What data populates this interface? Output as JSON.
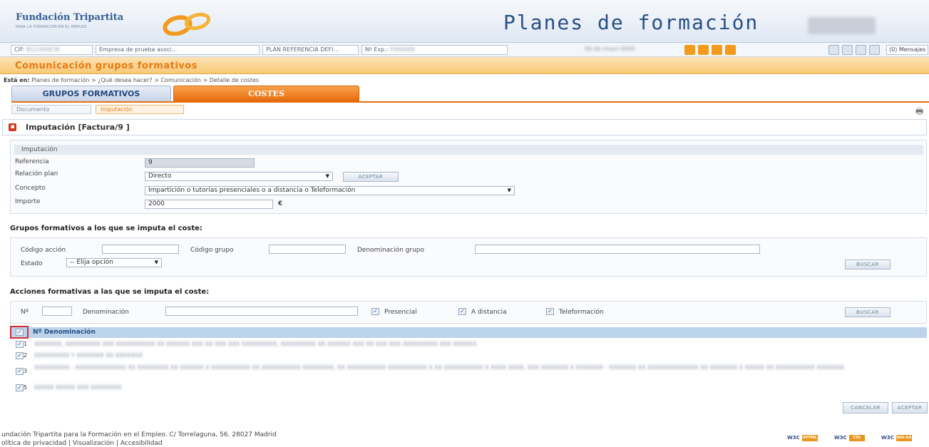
{
  "header": {
    "logo_name": "Fundación Tripartita",
    "logo_subtitle": "PARA LA FORMACIÓN EN EL EMPLEO",
    "app_title": "Planes de formación"
  },
  "infobar": {
    "cif_label": "CIF:",
    "cif_value": "B12345678",
    "empresa": "Empresa de prueba asoci...",
    "plan": "PLAN REFERENCIA DEFI...",
    "exp_label": "Nº Exp.:",
    "exp_value": "F000000",
    "date": "00 de mayo 0000",
    "messages": "(0) Mensajes"
  },
  "section": {
    "title": "Comunicación grupos formativos"
  },
  "breadcrumb": {
    "prefix": "Está en:",
    "path": "Planes de formación > ¿Qué desea hacer? > Comunicación > Detalle de costes"
  },
  "tabs": {
    "grupos": "GRUPOS FORMATIVOS",
    "costes": "COSTES"
  },
  "subtabs": {
    "documento": "Documento",
    "imputacion": "Imputación"
  },
  "panel": {
    "title": "Imputación [Factura/9 ]"
  },
  "imputacion": {
    "header": "Imputación",
    "referencia_label": "Referencia",
    "referencia_value": "9",
    "relacion_label": "Relación plan",
    "relacion_value": "Directo",
    "aceptar_small": "ACEPTAR",
    "concepto_label": "Concepto",
    "concepto_value": "Impartición o tutorías presenciales o a distancia o Teleformación",
    "importe_label": "Importe",
    "importe_value": "2000",
    "currency": "€"
  },
  "grupos_search": {
    "title": "Grupos formativos a los que se imputa el coste:",
    "codigo_accion": "Código acción",
    "codigo_grupo": "Código grupo",
    "denominacion_grupo": "Denominación grupo",
    "estado": "Estado",
    "estado_value": "-- Elija opción",
    "buscar": "BUSCAR"
  },
  "acciones_search": {
    "title": "Acciones formativas a las que se imputa el coste:",
    "num_label": "Nº",
    "denominacion_label": "Denominación",
    "presencial": "Presencial",
    "a_distancia": "A distancia",
    "teleformacion": "Teleformación",
    "buscar": "BUSCAR"
  },
  "table": {
    "header": "Nº Denominación",
    "check_mark": "✓",
    "rows": [
      {
        "num": "1",
        "den": "XXXXXXX, XXXXXXXXX XXX XXXXXXXXXX XX XXXXXX XXX XX XXX XXX XXXXXXXXX, XXXXXXXXX XX XXXXXX XXX XX XXX XXX XXXXXXXXX XXX XXXXXX"
      },
      {
        "num": "2",
        "den": "XXXXXXXXX Y XXXXXXX XX XXXXXXX"
      },
      {
        "num": "3",
        "den": "XXXXXXXXX - XXXXXXXXXXXXX XX XXXXXXXX XX XXXXXX X XXXXXXXXXX XX XXXXXXXXXX XXXXXXXX, XX XXXXXXXXXX XXXXXXXXXX X XX XXXXXXXXXX X XXXX XXXX, XXX XXXXXXX X XXXXXXX - XXXXXXX XX XXXXXXXXXXXXX XX XXXXXXX X XXXXX XX XXXXXXXXXX XXXXXXX"
      },
      {
        "num": "5",
        "den": "XXXXX XXXXX XXX XXXXXXXX"
      }
    ]
  },
  "actions": {
    "cancelar": "CANCELAR",
    "aceptar": "ACEPTAR"
  },
  "footer": {
    "line1": "undación Tripartita para la Formación en el Empleo. C/ Torrelaguna, 56. 28027 Madrid",
    "line2": "olítica de privacidad  |  Visualización  |  Accesibilidad",
    "badge_prefix": "W3C",
    "badge1": "XHTML 1.0",
    "badge2": "CSS",
    "badge3": "WAI-AA WCAG 1.0"
  },
  "colors": {
    "accent_orange": "#e96e10",
    "brand_blue": "#2a4e83",
    "alert_red": "#d32f2f"
  }
}
